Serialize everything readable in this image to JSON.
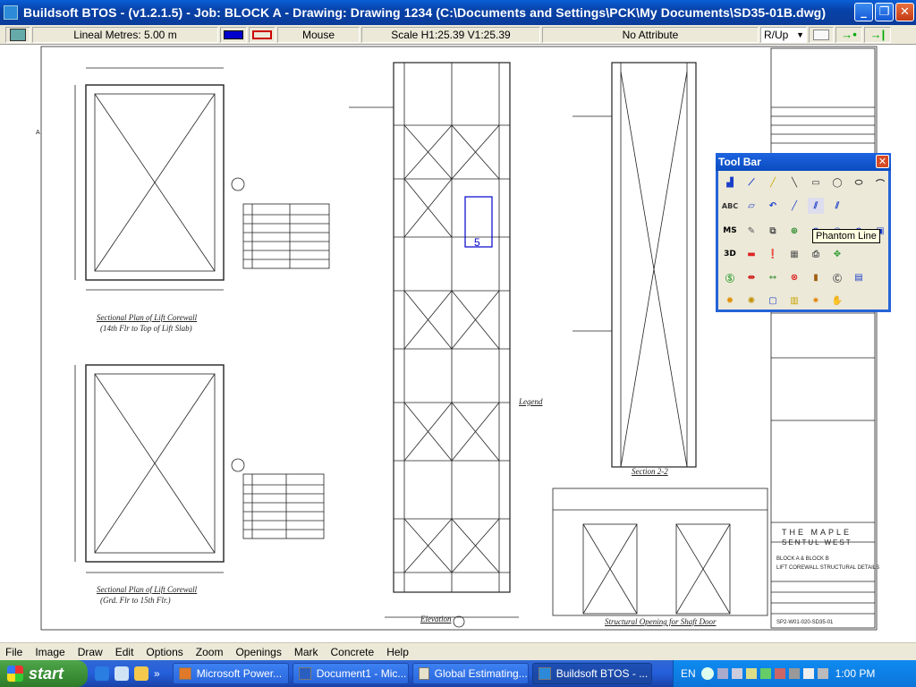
{
  "window": {
    "title": "Buildsoft BTOS - (v1.2.1.5) - Job: BLOCK A - Drawing: Drawing 1234 (C:\\Documents and Settings\\PCK\\My Documents\\SD35-01B.dwg)",
    "minimize": "_",
    "maximize": "❐",
    "close": "✕"
  },
  "status": {
    "lineal_metres": "Lineal Metres:  5.00 m",
    "mode": "Mouse",
    "scale": "Scale H1:25.39 V1:25.39",
    "attribute": "No Attribute",
    "direction": "R/Up",
    "direction_options": [
      "R/Up"
    ]
  },
  "drawing": {
    "plan_label_1": "Sectional Plan of Lift Corewall",
    "plan_label_1b": "(14th Flr to Top of Lift Slab)",
    "plan_label_2": "Sectional Plan of Lift Corewall",
    "plan_label_2b": "(Grd. Flr to 15th Flr.)",
    "elevation_label": "Elevation",
    "section_label": "Section 2-2",
    "opening_label": "Structural Opening for Shaft Door",
    "legend_label": "Legend",
    "marker_number": "5",
    "title_block_1": "THE MAPLE",
    "title_block_2": "SENTUL WEST",
    "title_block_3": "BLOCK A & BLOCK B",
    "title_block_4": "LIFT COREWALL STRUCTURAL DETAILS",
    "title_block_5": "SP2-W01-020-SD35-01"
  },
  "toolbar": {
    "title": "Tool Bar",
    "close": "✕",
    "tooltip": "Phantom Line",
    "text_abc": "ABC",
    "text_ms": "MS",
    "text_3d": "3D"
  },
  "menu": {
    "items": [
      "File",
      "Image",
      "Draw",
      "Edit",
      "Options",
      "Zoom",
      "Openings",
      "Mark",
      "Concrete",
      "Help"
    ]
  },
  "taskbar": {
    "start": "start",
    "overflow": "»",
    "tasks": [
      "Microsoft Power...",
      "Document1 - Mic...",
      "Global Estimating...",
      "Buildsoft BTOS - ..."
    ],
    "lang": "EN",
    "clock": "1:00 PM"
  },
  "colors": {
    "title_blue": "#0a4fc0",
    "line_blue": "#0000cc",
    "line_red": "#cc0000",
    "green_arrow": "#00aa00"
  }
}
